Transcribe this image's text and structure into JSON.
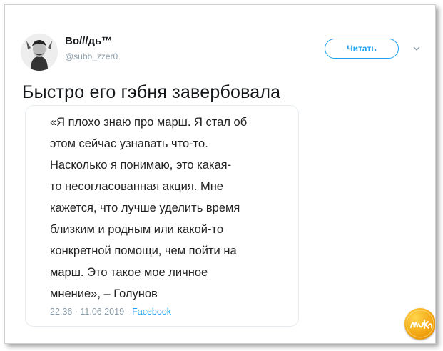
{
  "tweet": {
    "author_name": "Во///дь™",
    "author_handle": "@subb_zzer0",
    "follow_label": "Читать",
    "text": "Быстро его гэбня завербовала"
  },
  "quote": {
    "lines": [
      "«Я плохо знаю про марш. Я стал об",
      "этом сейчас узнавать что-то.",
      "Насколько я понимаю, это какая-",
      "то несогласованная акция. Мне",
      "кажется, что лучше уделить время",
      "близким и родным или какой-то",
      "конкретной помощи, чем пойти на",
      "марш. Это такое мое личное",
      "мнение», – Голунов"
    ],
    "timestamp": "22:36 · 11.06.2019 · ",
    "source": "Facebook"
  },
  "colors": {
    "accent": "#1da1f2",
    "text": "#14171a",
    "muted": "#8a9ba8",
    "logo": "#f2a20e"
  },
  "icons": [
    "avatar-portrait",
    "chevron-down-icon",
    "site-logo"
  ]
}
